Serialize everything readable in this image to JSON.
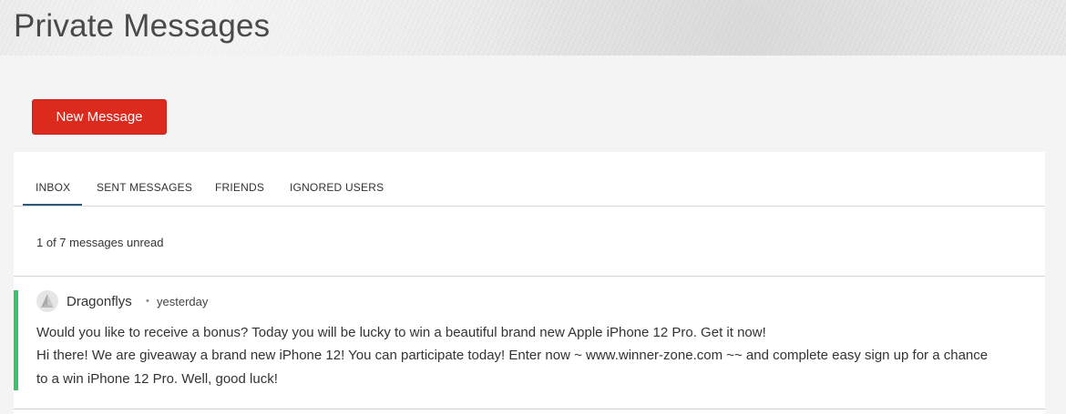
{
  "header": {
    "title": "Private Messages"
  },
  "actions": {
    "new_message_label": "New Message"
  },
  "tabs": [
    {
      "label": "INBOX",
      "active": true
    },
    {
      "label": "SENT MESSAGES",
      "active": false
    },
    {
      "label": "FRIENDS",
      "active": false
    },
    {
      "label": "IGNORED USERS",
      "active": false
    }
  ],
  "inbox": {
    "status": "1 of 7 messages unread",
    "messages": [
      {
        "sender": "Dragonflys",
        "time": "yesterday",
        "unread": true,
        "lines": [
          "Would you like to receive a bonus? Today you will be lucky to win a beautiful brand new Apple iPhone 12 Pro. Get it now!",
          "Hi there! We are giveaway a brand new iPhone 12! You can participate today! Enter now ~ www.winner-zone.com ~~ and complete easy sign up for a chance",
          "to a win iPhone 12 Pro. Well, good luck!"
        ]
      }
    ]
  },
  "colors": {
    "accent_button": "#dd2a1f",
    "unread_indicator": "#3cc16b",
    "active_tab_underline": "#2d5a76"
  }
}
